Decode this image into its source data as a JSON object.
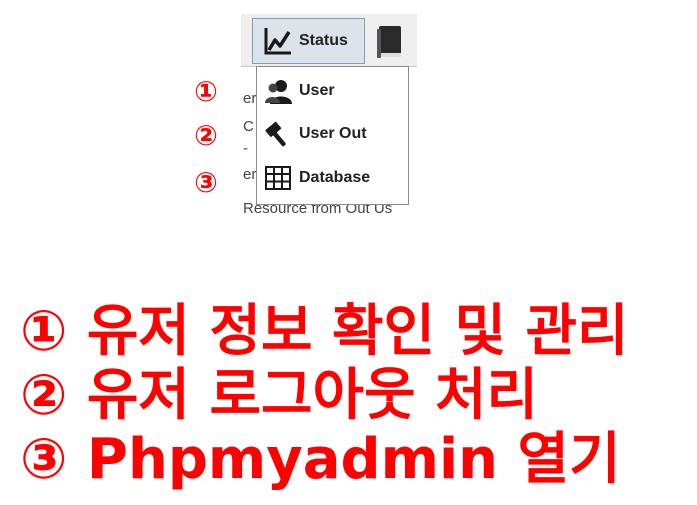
{
  "toolbar": {
    "status_label": "Status"
  },
  "background_text": {
    "line1": "er",
    "line2": "C",
    "line3": "-",
    "line4": "er",
    "line5": "Resource from Out Us"
  },
  "menu": {
    "items": [
      {
        "label": "User",
        "icon": "user-icon"
      },
      {
        "label": "User Out",
        "icon": "hammer-icon"
      },
      {
        "label": "Database",
        "icon": "table-grid-icon"
      }
    ]
  },
  "markers": [
    "①",
    "②",
    "③"
  ],
  "legend": {
    "line1": "① 유저 정보 확인 및 관리",
    "line2": "② 유저 로그아웃 처리",
    "line3": "③ Phpmyadmin 열기"
  },
  "colors": {
    "annotation": "#ff0000",
    "status_button_bg": "#dde3ea",
    "toolbar_bg": "#eeeeee"
  }
}
